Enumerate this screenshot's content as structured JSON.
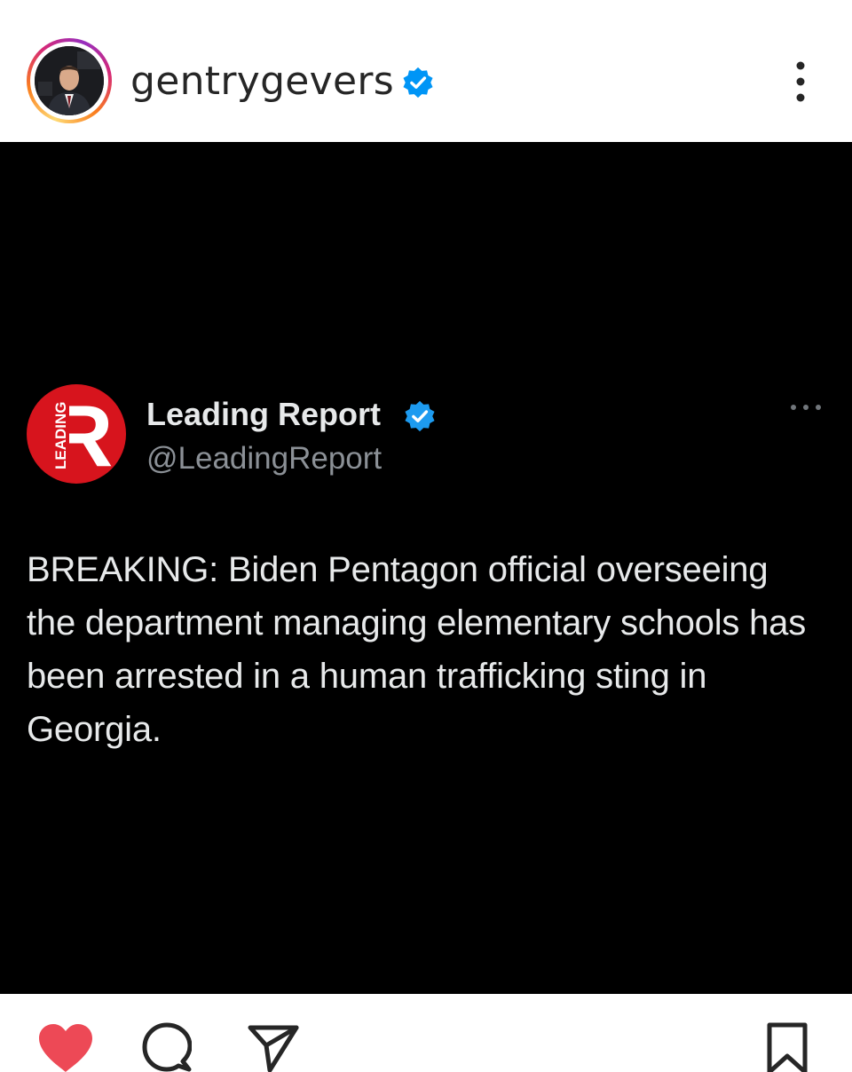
{
  "header": {
    "username": "gentrygevers",
    "verified_icon": "verified-badge-icon",
    "more_icon": "more-vertical-icon"
  },
  "tweet": {
    "logo_letter": "R",
    "logo_text": "LEADING",
    "display_name": "Leading Report",
    "handle": "@LeadingReport",
    "body": "BREAKING: Biden Pentagon official overseeing the department managing elementary schools has been arrested in a human trafficking sting in Georgia.",
    "more_icon": "more-horizontal-icon"
  },
  "actions": {
    "like_icon": "heart-icon",
    "liked": true,
    "comment_icon": "comment-icon",
    "share_icon": "send-icon",
    "save_icon": "bookmark-icon"
  },
  "colors": {
    "like": "#ed4956",
    "verified": "#0095f6",
    "tweet_verified": "#1d9bf0",
    "logo_red": "#d7141d",
    "post_bg": "#000000"
  }
}
